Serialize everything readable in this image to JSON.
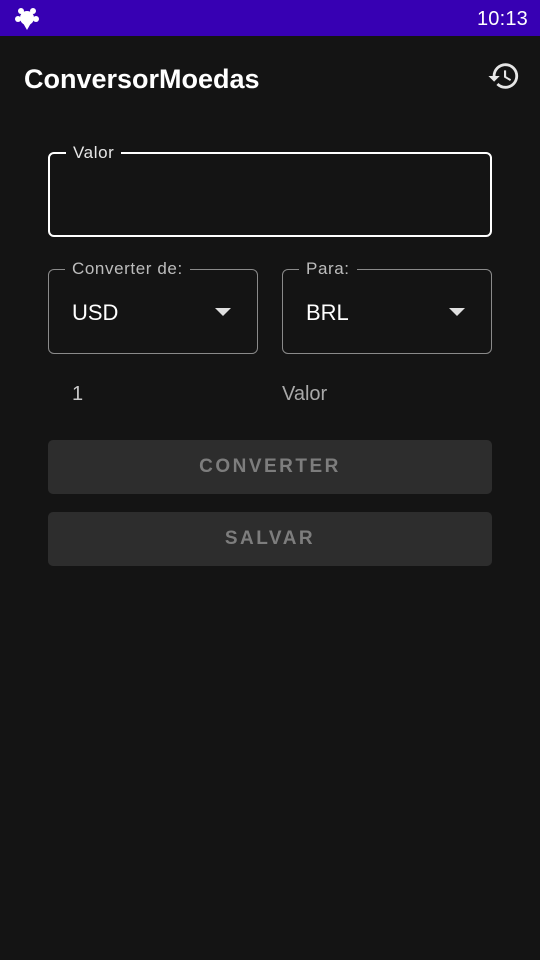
{
  "status_bar": {
    "time": "10:13",
    "app_icon": "app-launcher-icon",
    "background": "#3700b3"
  },
  "toolbar": {
    "title": "ConversorMoedas",
    "history_icon": "history-icon"
  },
  "form": {
    "value_field": {
      "label": "Valor",
      "value": ""
    },
    "from_currency": {
      "label": "Converter de:",
      "selected": "USD"
    },
    "to_currency": {
      "label": "Para:",
      "selected": "BRL"
    },
    "amount_text": "1",
    "result_text": "Valor"
  },
  "buttons": {
    "convert_label": "CONVERTER",
    "save_label": "SALVAR"
  },
  "colors": {
    "background": "#141414",
    "button_bg": "#2d2d2d",
    "button_text": "#7d7d7d"
  }
}
